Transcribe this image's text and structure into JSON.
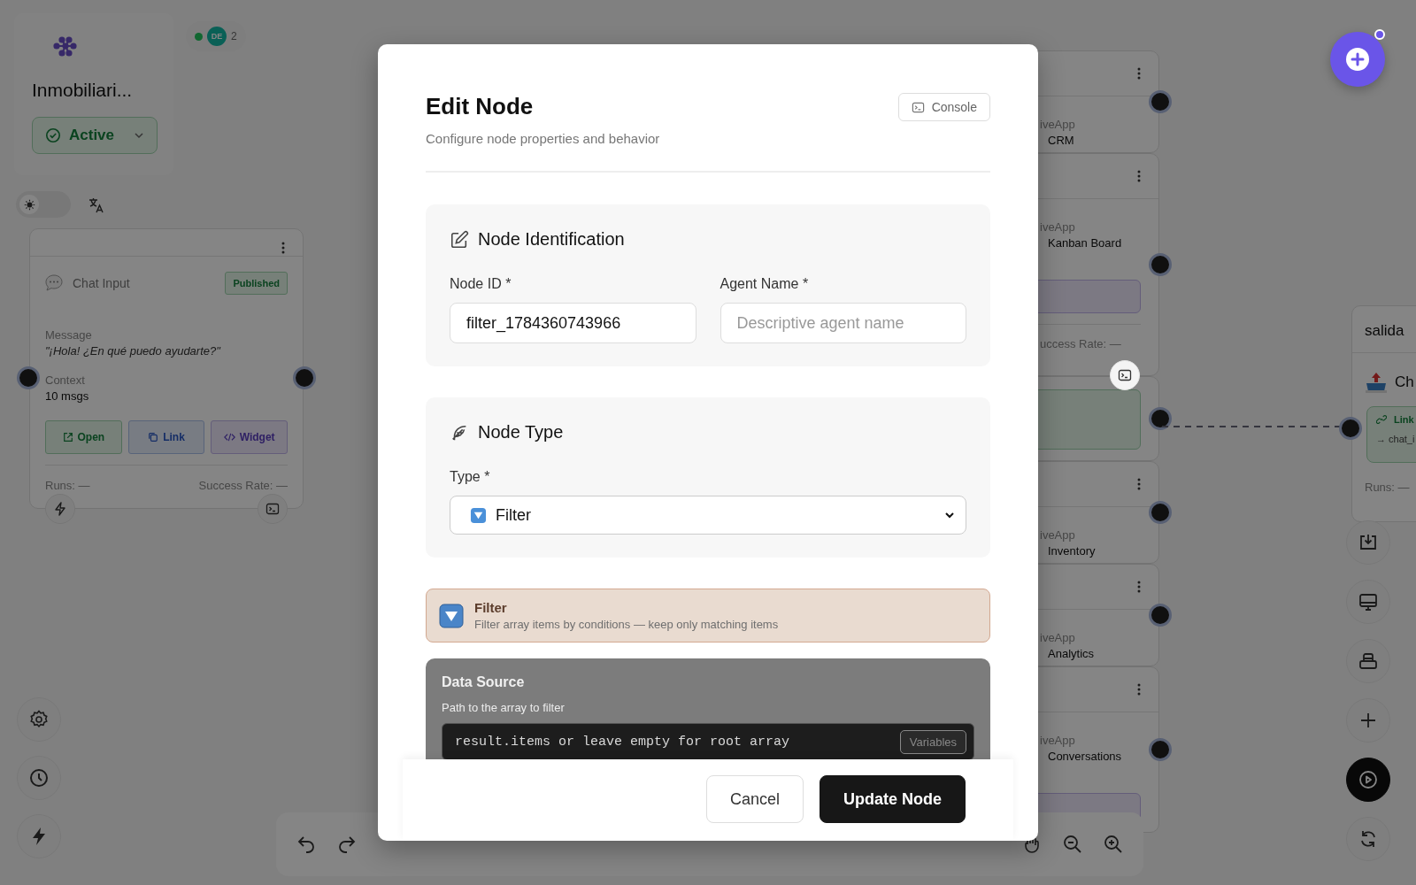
{
  "workspace": {
    "title": "Inmobiliari...",
    "status": "Active"
  },
  "presence": {
    "online": true,
    "initials": "DE",
    "count": "2"
  },
  "theme_toggle": {
    "dark": false
  },
  "chat_node": {
    "title": "Chat Input",
    "badge": "Published",
    "fields": [
      {
        "label": "Message",
        "value": "\"¡Hola! ¿En qué puedo ayudarte?\"",
        "kind": "quote"
      },
      {
        "label": "Context",
        "value": "10 msgs",
        "kind": "plain"
      }
    ],
    "actions": [
      {
        "label": "Open",
        "kind": "open"
      },
      {
        "label": "Link",
        "kind": "link"
      },
      {
        "label": "Widget",
        "kind": "widget"
      }
    ],
    "runs": "Runs: —",
    "success_rate": "Success Rate: —"
  },
  "side_cards": [
    {
      "kind": "plain",
      "app": "iveApp",
      "name": "CRM"
    },
    {
      "kind": "widget",
      "app": "iveApp",
      "name": "Kanban Board",
      "footer": "uccess Rate: —"
    },
    {
      "kind": "open"
    },
    {
      "kind": "plain",
      "app": "iveApp",
      "name": "Inventory"
    },
    {
      "kind": "plain",
      "app": "iveApp",
      "name": "Analytics"
    },
    {
      "kind": "widget",
      "app": "iveApp",
      "name": "Conversations"
    }
  ],
  "output_node": {
    "title": "salida",
    "label": "Ch",
    "link": "Link",
    "target": "→ chat_i",
    "runs": "Runs: —"
  },
  "modal": {
    "title": "Edit Node",
    "subtitle": "Configure node properties and behavior",
    "console_button": "Console",
    "identification": {
      "heading": "Node Identification",
      "fields": [
        {
          "label": "Node ID *",
          "value": "filter_1784360743966"
        },
        {
          "label": "Agent Name *",
          "placeholder": "Descriptive agent name"
        }
      ]
    },
    "node_type": {
      "heading": "Node Type",
      "label": "Type *",
      "value": "Filter"
    },
    "info": {
      "title": "Filter",
      "description": "Filter array items by conditions — keep only matching items"
    },
    "data_source": {
      "label": "Data Source",
      "hint": "Path to the array to filter",
      "placeholder": "result.items or leave empty for root array",
      "variables": "Variables"
    },
    "buttons": [
      {
        "label": "Cancel",
        "kind": "secondary"
      },
      {
        "label": "Update Node",
        "kind": "primary"
      }
    ]
  }
}
